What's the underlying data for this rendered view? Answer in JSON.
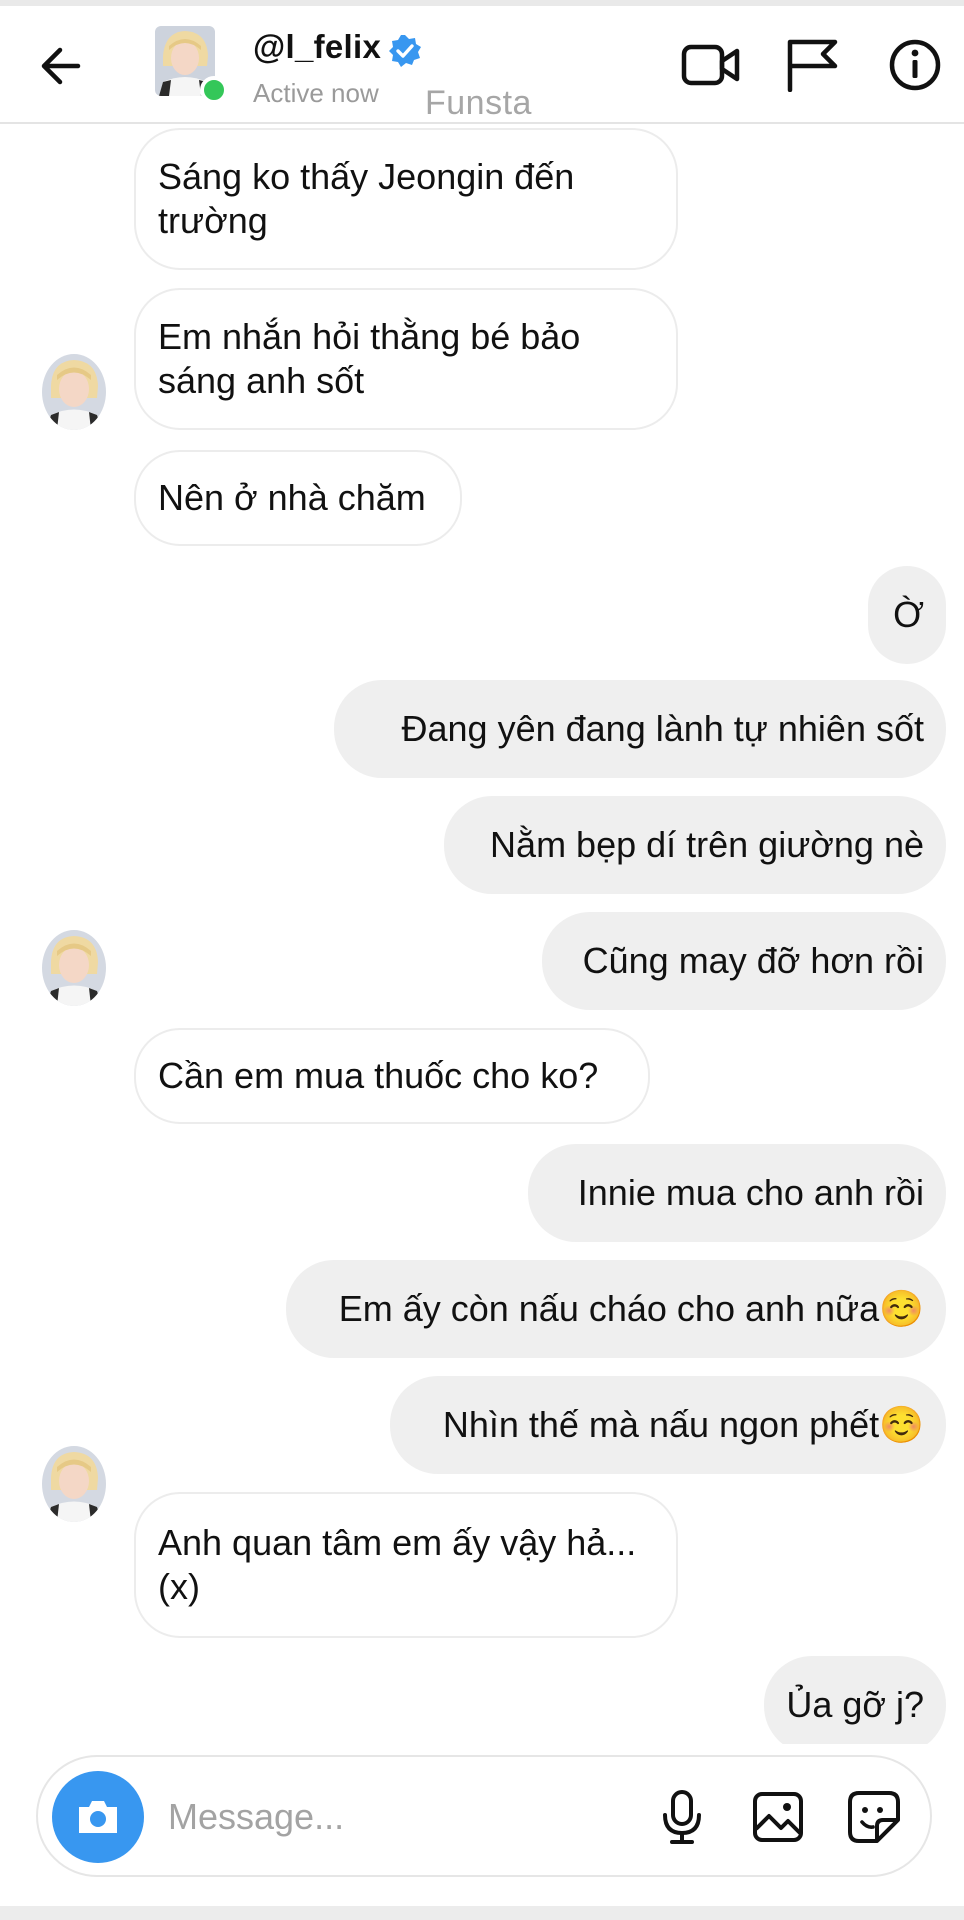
{
  "header": {
    "username": "@l_felix",
    "status": "Active now",
    "overlay_text": "Funsta",
    "verified": true,
    "icons": [
      "back-arrow-icon",
      "video-call-icon",
      "flag-icon",
      "info-icon"
    ]
  },
  "messages": [
    {
      "side": "in",
      "text": "Sáng ko thấy Jeongin đến trường",
      "avatar": false
    },
    {
      "side": "in",
      "text": "Em nhắn hỏi thằng bé bảo sáng anh sốt",
      "avatar": false
    },
    {
      "side": "in",
      "text": "Nên ở nhà chăm",
      "avatar": true
    },
    {
      "side": "out",
      "text": "Ờ"
    },
    {
      "side": "out",
      "text": "Đang yên đang lành tự nhiên sốt"
    },
    {
      "side": "out",
      "text": "Nằm bẹp dí trên giường nè"
    },
    {
      "side": "out",
      "text": "Cũng may đỡ hơn rồi"
    },
    {
      "side": "in",
      "text": "Cần em mua thuốc cho ko?",
      "avatar": true
    },
    {
      "side": "out",
      "text": "Innie mua cho anh rồi"
    },
    {
      "side": "out",
      "text": "Em ấy còn nấu cháo cho anh nữa☺️"
    },
    {
      "side": "out",
      "text": "Nhìn thế mà nấu ngon phết☺️"
    },
    {
      "side": "in",
      "text": "Anh quan tâm em ấy vậy hả...(x)",
      "avatar": true
    },
    {
      "side": "out",
      "text": "Ủa gỡ j?"
    }
  ],
  "composer": {
    "placeholder": "Message...",
    "icons": [
      "camera-icon",
      "microphone-icon",
      "gallery-icon",
      "sticker-icon"
    ]
  },
  "colors": {
    "accent": "#3897f0",
    "online": "#34c759",
    "outgoing_bubble": "#efefef",
    "incoming_border": "#ececec"
  }
}
